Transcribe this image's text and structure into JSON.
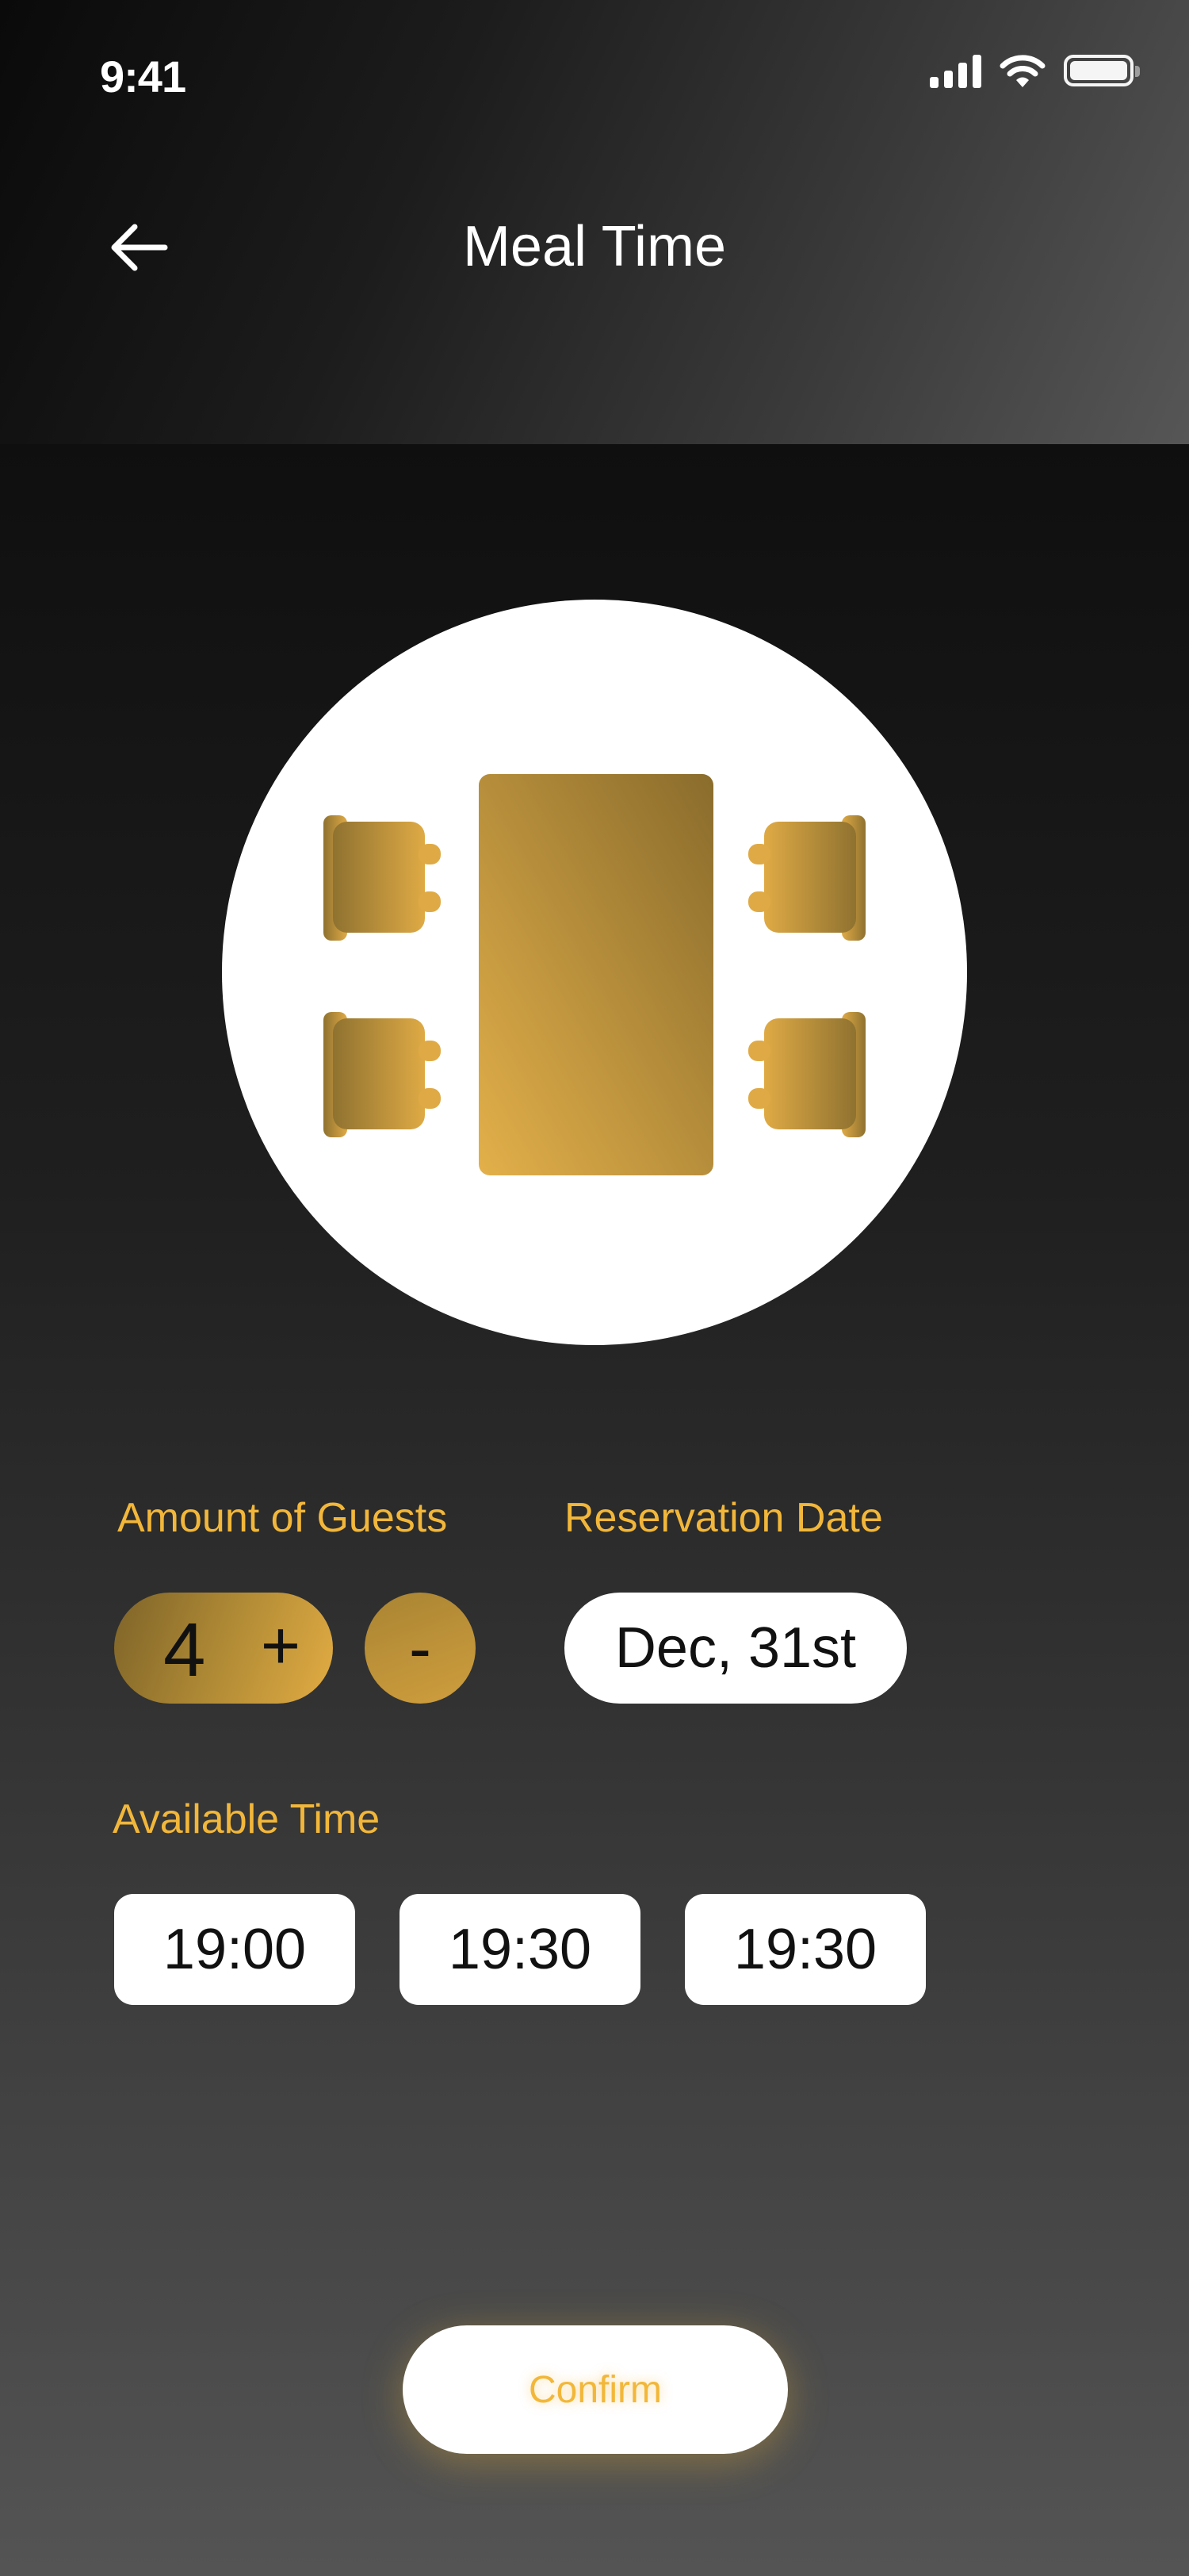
{
  "status_bar": {
    "time": "9:41"
  },
  "header": {
    "title": "Meal Time"
  },
  "icons": {
    "back": "arrow-left-icon",
    "signal": "cellular-signal-icon",
    "wifi": "wifi-icon",
    "battery": "battery-icon",
    "table": "dining-table-icon",
    "chair": "chair-icon"
  },
  "colors": {
    "accent": "#f2b73a",
    "gold_dark": "#7e6429",
    "gold_light": "#e2ac43",
    "card": "#ffffff"
  },
  "guests": {
    "label": "Amount of Guests",
    "count": "4",
    "plus_label": "+",
    "minus_label": "-"
  },
  "reservation": {
    "label": "Reservation Date",
    "date": "Dec, 31st"
  },
  "times": {
    "label": "Available Time",
    "slots": [
      "19:00",
      "19:30",
      "19:30"
    ]
  },
  "confirm": {
    "label": "Confirm"
  }
}
